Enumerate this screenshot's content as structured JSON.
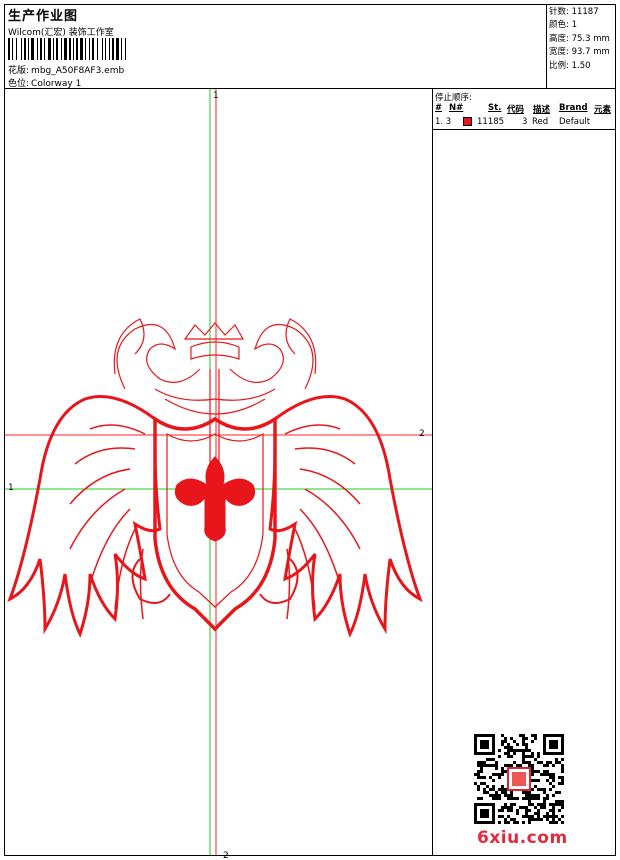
{
  "header": {
    "title": "生产作业图",
    "company": "Wilcom(汇宏) 装饰工作室",
    "design_label": "花版:",
    "design_value": "mbg_A50F8AF3.emb",
    "colorway_label": "色位:",
    "colorway_value": "Colorway 1"
  },
  "stats": [
    {
      "label": "针数:",
      "value": "11187"
    },
    {
      "label": "颜色:",
      "value": "1"
    },
    {
      "label": "高度:",
      "value": "75.3 mm"
    },
    {
      "label": "宽度:",
      "value": "93.7 mm"
    },
    {
      "label": "比例:",
      "value": "1.50"
    }
  ],
  "stop_sequence": {
    "title": "停止顺序:",
    "columns": [
      "#",
      "N#",
      "St.",
      "代码",
      "描述",
      "Brand",
      "元素"
    ],
    "rows": [
      {
        "num": "1. 3",
        "stitches": "11185",
        "code": "3",
        "color_name": "Red",
        "brand": "Default",
        "swatch": "#e8161b"
      }
    ]
  },
  "guides": {
    "top_label": "1",
    "bottom_label": "2",
    "right_label": "2",
    "left_label": "1"
  },
  "colors": {
    "thread": "#e8161b",
    "guide_red": "#ff2020",
    "guide_green": "#22cc22"
  },
  "watermark": {
    "site": "6xiu.com"
  }
}
